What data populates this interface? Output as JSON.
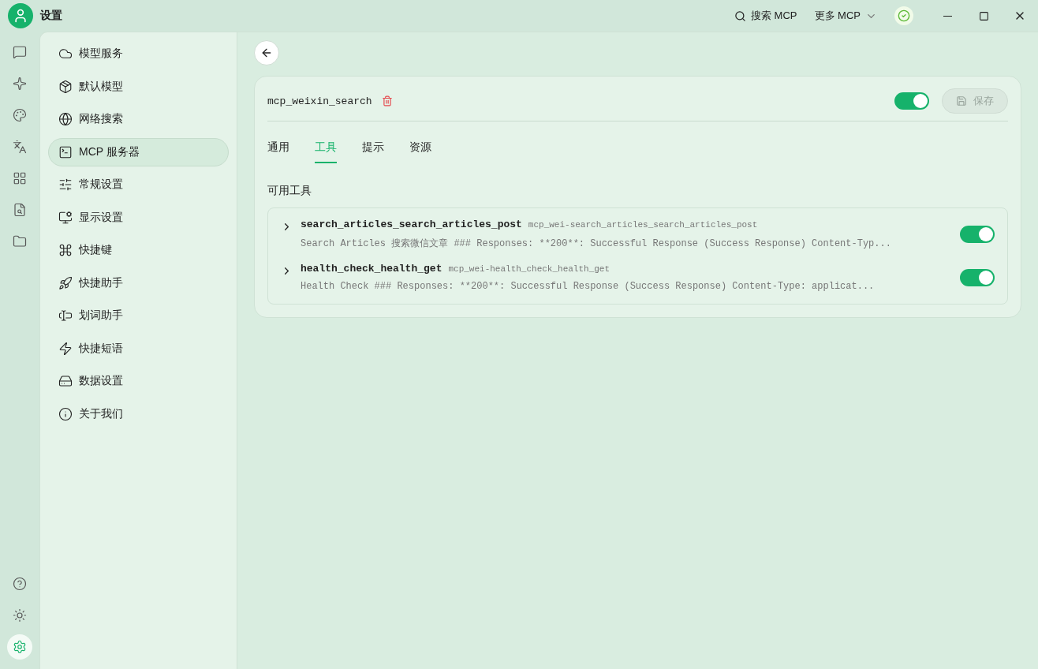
{
  "window": {
    "title": "设置"
  },
  "topbar": {
    "search_label": "搜索 MCP",
    "more_label": "更多 MCP"
  },
  "rail": {
    "top": [
      {
        "selected": false
      },
      {
        "selected": false
      },
      {
        "selected": false
      },
      {
        "selected": false
      },
      {
        "selected": false
      },
      {
        "selected": false
      },
      {
        "selected": false
      }
    ],
    "bottom": [
      {
        "selected": false
      },
      {
        "selected": false
      },
      {
        "selected": true
      }
    ]
  },
  "sidebar": {
    "items": [
      {
        "label": "模型服务",
        "selected": false
      },
      {
        "label": "默认模型",
        "selected": false
      },
      {
        "label": "网络搜索",
        "selected": false
      },
      {
        "label": "MCP 服务器",
        "selected": true
      },
      {
        "label": "常规设置",
        "selected": false
      },
      {
        "label": "显示设置",
        "selected": false
      },
      {
        "label": "快捷键",
        "selected": false
      },
      {
        "label": "快捷助手",
        "selected": false
      },
      {
        "label": "划词助手",
        "selected": false
      },
      {
        "label": "快捷短语",
        "selected": false
      },
      {
        "label": "数据设置",
        "selected": false
      },
      {
        "label": "关于我们",
        "selected": false
      }
    ]
  },
  "server": {
    "name": "mcp_weixin_search",
    "enabled": true,
    "save_button": {
      "label": "保存",
      "disabled": true
    }
  },
  "tabs": [
    {
      "label": "通用",
      "selected": false
    },
    {
      "label": "工具",
      "selected": true
    },
    {
      "label": "提示",
      "selected": false
    },
    {
      "label": "资源",
      "selected": false
    }
  ],
  "section_title": "可用工具",
  "tools": [
    {
      "name": "search_articles_search_articles_post",
      "id": "mcp_wei-search_articles_search_articles_post",
      "description": "Search Articles 搜索微信文章 ### Responses: **200**: Successful Response (Success Response) Content-Typ...",
      "enabled": true,
      "expanded": false
    },
    {
      "name": "health_check_health_get",
      "id": "mcp_wei-health_check_health_get",
      "description": "Health Check ### Responses: **200**: Successful Response (Success Response) Content-Type: applicat...",
      "enabled": true,
      "expanded": false
    }
  ]
}
